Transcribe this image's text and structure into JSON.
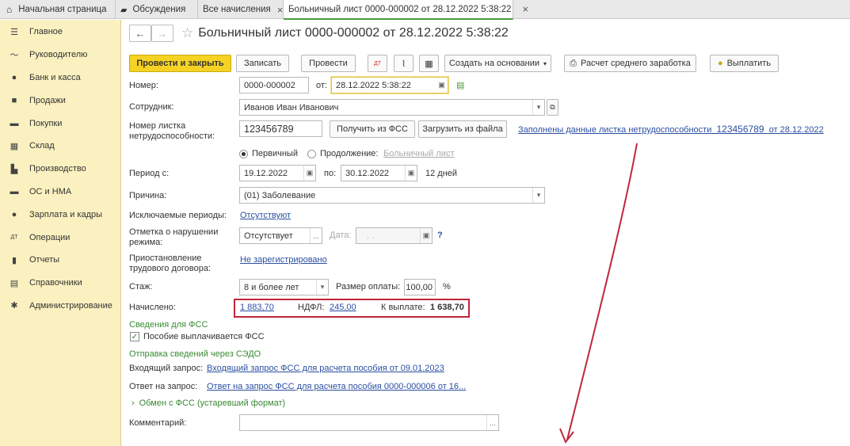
{
  "tabs": [
    {
      "label": "Начальная страница"
    },
    {
      "label": "Обсуждения"
    },
    {
      "label": "Все начисления"
    },
    {
      "label": "Больничный лист 0000-000002 от 28.12.2022 5:38:22"
    }
  ],
  "sidebar": {
    "items": [
      {
        "label": "Главное",
        "icon": "menu-icon"
      },
      {
        "label": "Руководителю",
        "icon": "trend-icon"
      },
      {
        "label": "Банк и касса",
        "icon": "coin-icon"
      },
      {
        "label": "Продажи",
        "icon": "bag-icon"
      },
      {
        "label": "Покупки",
        "icon": "cart-icon"
      },
      {
        "label": "Склад",
        "icon": "warehouse-icon"
      },
      {
        "label": "Производство",
        "icon": "factory-icon"
      },
      {
        "label": "ОС и НМА",
        "icon": "truck-icon"
      },
      {
        "label": "Зарплата и кадры",
        "icon": "person-icon"
      },
      {
        "label": "Операции",
        "icon": "dt-kt-icon"
      },
      {
        "label": "Отчеты",
        "icon": "chart-icon"
      },
      {
        "label": "Справочники",
        "icon": "book-icon"
      },
      {
        "label": "Администрирование",
        "icon": "gear-icon"
      }
    ]
  },
  "doc": {
    "title": "Больничный лист 0000-000002 от 28.12.2022 5:38:22"
  },
  "toolbar": {
    "post_close": "Провести и закрыть",
    "save": "Записать",
    "post": "Провести",
    "create_based": "Создать на основании",
    "calc_avg": "Расчет среднего заработка",
    "pay": "Выплатить"
  },
  "form": {
    "number_label": "Номер:",
    "number_value": "0000-000002",
    "from_label": "от:",
    "date_value": "28.12.2022  5:38:22",
    "employee_label": "Сотрудник:",
    "employee_value": "Иванов Иван Иванович",
    "sheet_label": "Номер листка нетрудоспособности:",
    "sheet_value": "123456789",
    "get_fss": "Получить из ФСС",
    "load_file": "Загрузить из файла",
    "filled_link_a": "Заполнены данные листка нетрудоспособности",
    "filled_link_num": "123456789",
    "filled_link_b": "от 28.12.2022",
    "primary": "Первичный",
    "continuation": "Продолжение:",
    "continuation_link": "Больничный лист",
    "period_label": "Период с:",
    "period_from": "19.12.2022",
    "period_to_label": "по:",
    "period_to": "30.12.2022",
    "days": "12 дней",
    "reason_label": "Причина:",
    "reason_value": "(01) Заболевание",
    "excluded_label": "Исключаемые периоды:",
    "excluded_value": "Отсутствуют",
    "violation_label": "Отметка о нарушении режима:",
    "violation_value": "Отсутствует",
    "violation_date_label": "Дата:",
    "violation_date_value": ". .",
    "help": "?",
    "suspend_label": "Приостановление трудового договора:",
    "suspend_value": "Не зарегистрировано",
    "experience_label": "Стаж:",
    "experience_value": "8 и более лет",
    "pay_size_label": "Размер оплаты:",
    "pay_size_value": "100,00",
    "percent": "%",
    "accrued_label": "Начислено:",
    "accrued_value": "1 883,70",
    "ndfl_label": "НДФЛ:",
    "ndfl_value": "245,00",
    "payout_label": "К выплате:",
    "payout_value": "1 638,70",
    "fss_section": "Сведения для ФСС",
    "fss_paid": "Пособие выплачивается ФСС",
    "sedo_section": "Отправка сведений через СЭДО",
    "incoming_label": "Входящий запрос:",
    "incoming_value": "Входящий запрос ФСС для расчета пособия  от 09.01.2023",
    "answer_label": "Ответ на запрос:",
    "answer_value": "Ответ на запрос ФСС для расчета пособия 0000-000006 от 16...",
    "exchange": "Обмен с ФСС (устаревший формат)",
    "comment_label": "Комментарий:",
    "comment_value": ""
  },
  "colors": {
    "accent": "#f5d223",
    "sidebar_bg": "#fbf1c0",
    "link": "#2b4fa1",
    "section": "#3a8a33",
    "highlight": "#c0263a"
  }
}
